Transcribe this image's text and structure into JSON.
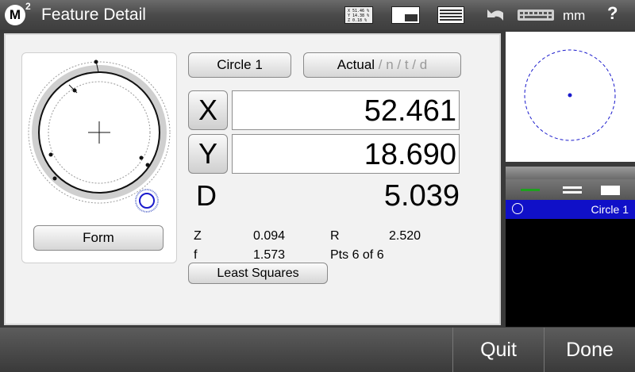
{
  "header": {
    "logo_text": "M",
    "logo_sup": "2",
    "title": "Feature Detail",
    "units": "mm",
    "help": "?",
    "readout_icon_lines": [
      "X 51.46 %",
      "Y 14.38 %",
      "Z 0.18 %"
    ]
  },
  "feature": {
    "name_button": "Circle 1",
    "actual_label": "Actual",
    "actual_suffix": " / n / t / d",
    "x_label": "X",
    "x_value": "52.461",
    "y_label": "Y",
    "y_value": "18.690",
    "d_label": "D",
    "d_value": "5.039",
    "form_button": "Form",
    "fit_button": "Least Squares"
  },
  "stats": {
    "z_label": "Z",
    "z_value": "0.094",
    "r_label": "R",
    "r_value": "2.520",
    "f_label": "f",
    "f_value": "1.573",
    "pts_text": "Pts 6 of 6"
  },
  "feature_list": {
    "items": [
      {
        "label": "Circle 1",
        "selected": true
      }
    ]
  },
  "footer": {
    "quit_label": "Quit",
    "done_label": "Done"
  },
  "colors": {
    "selection": "#1010c8",
    "accent_green": "#1ea01e",
    "circle_blue": "#1a1acc"
  }
}
